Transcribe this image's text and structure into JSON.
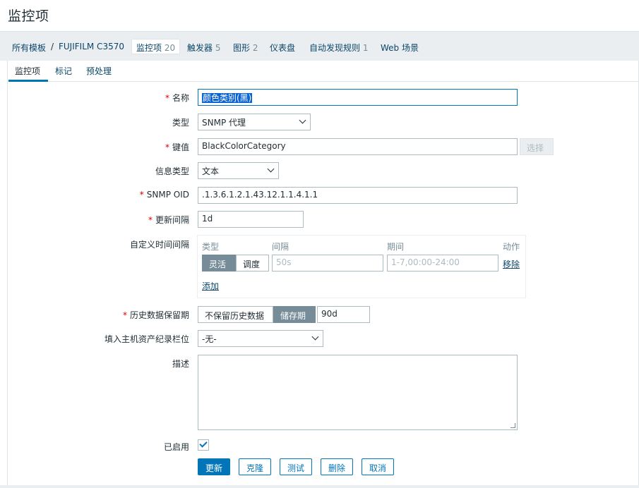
{
  "page": {
    "title": "监控项"
  },
  "breadcrumb": {
    "templates": "所有模板",
    "separator": "/",
    "host": "FUJIFILM C3570",
    "current_label": "监控项",
    "current_count": "20",
    "triggers_label": "触发器",
    "triggers_count": "5",
    "graphs_label": "图形",
    "graphs_count": "2",
    "dashboards_label": "仪表盘",
    "discovery_label": "自动发现规则",
    "discovery_count": "1",
    "web_label": "Web 场景"
  },
  "tabs": [
    "监控项",
    "标记",
    "预处理"
  ],
  "form": {
    "name_label": "名称",
    "name_value": "颜色类别(黑)",
    "type_label": "类型",
    "type_value": "SNMP 代理",
    "key_label": "键值",
    "key_value": "BlackColorCategory",
    "key_select_button": "选择",
    "info_type_label": "信息类型",
    "info_type_value": "文本",
    "oid_label": "SNMP OID",
    "oid_value": ".1.3.6.1.2.1.43.12.1.1.4.1.1",
    "interval_label": "更新间隔",
    "interval_value": "1d",
    "custom_intervals": {
      "label": "自定义时间间隔",
      "col_type": "类型",
      "col_interval": "间隔",
      "col_period": "期间",
      "col_action": "动作",
      "flexible": "灵活",
      "scheduling": "调度",
      "interval_placeholder": "50s",
      "period_placeholder": "1-7,00:00-24:00",
      "remove": "移除",
      "add": "添加"
    },
    "history_label": "历史数据保留期",
    "history_no_keep": "不保留历史数据",
    "history_store": "储存期",
    "history_value": "90d",
    "inventory_label": "填入主机资产纪录栏位",
    "inventory_value": "-无-",
    "description_label": "描述",
    "description_value": "",
    "enabled_label": "已启用",
    "enabled": true
  },
  "actions": {
    "update": "更新",
    "clone": "克隆",
    "test": "测试",
    "delete": "删除",
    "cancel": "取消"
  },
  "colors": {
    "accent": "#0275b8",
    "required": "#d40000",
    "nav_bg": "#ebeef0",
    "toggle_active": "#768d99"
  }
}
